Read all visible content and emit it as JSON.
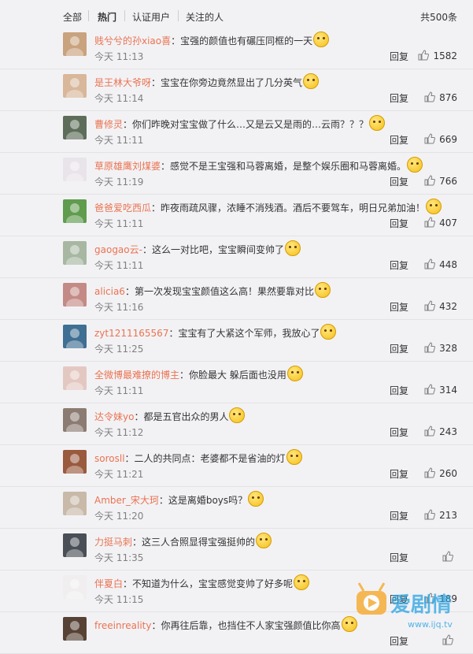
{
  "tabs": {
    "all": "全部",
    "hot": "热门",
    "verified": "认证用户",
    "following": "关注的人",
    "total": "共500条"
  },
  "labels": {
    "reply": "回复"
  },
  "comments": [
    {
      "user": "贱兮兮的孙xiao喜",
      "text": "：宝强的颜值也有碾压同框的一天",
      "time": "今天 11:13",
      "likes": "1582",
      "avatar": "#c9a27e"
    },
    {
      "user": "是王林大爷呀",
      "text": "：宝宝在你旁边竟然显出了几分英气",
      "time": "今天 11:14",
      "likes": "876",
      "avatar": "#d8b79a"
    },
    {
      "user": "曹修灵",
      "text": "：你们昨晚对宝宝做了什么…又是云又是雨的…云雨？？？",
      "time": "今天 11:11",
      "likes": "669",
      "avatar": "#5d6d5a"
    },
    {
      "user": "草原雄鹰刘煤婆",
      "text": "：感觉不是王宝强和马蓉离婚，是整个娱乐圈和马蓉离婚。",
      "time": "今天 11:19",
      "likes": "766",
      "avatar": "#e9e4ea"
    },
    {
      "user": "爸爸爱吃西瓜",
      "text": "：昨夜雨疏风骤，浓睡不消残酒。酒后不要驾车，明日兄弟加油！",
      "time": "今天 11:11",
      "likes": "407",
      "avatar": "#5f9c4e"
    },
    {
      "user": "gaogao云-",
      "text": "：这么一对比吧，宝宝瞬间变帅了",
      "time": "今天 11:11",
      "likes": "448",
      "avatar": "#a7b7a2"
    },
    {
      "user": "alicia6",
      "text": "：第一次发现宝宝颜值这么高！果然要靠对比",
      "time": "今天 11:16",
      "likes": "432",
      "avatar": "#c48a86"
    },
    {
      "user": "zyt1211165567",
      "text": "：宝宝有了大紧这个军师，我放心了",
      "time": "今天 11:25",
      "likes": "328",
      "avatar": "#3f6f92"
    },
    {
      "user": "全微博最难撩的博主",
      "text": "：你脸最大 躲后面也没用",
      "time": "今天 11:11",
      "likes": "314",
      "avatar": "#e3c8c2"
    },
    {
      "user": "达令妹yo",
      "text": "：都是五官出众的男人",
      "time": "今天 11:12",
      "likes": "243",
      "avatar": "#8c7b72"
    },
    {
      "user": "sorosll",
      "text": "：二人的共同点：老婆都不是省油的灯",
      "time": "今天 11:21",
      "likes": "260",
      "avatar": "#9a5a3e"
    },
    {
      "user": "Amber_宋大珂",
      "text": "：这是离婚boys吗？",
      "time": "今天 11:20",
      "likes": "213",
      "avatar": "#c8b9a8"
    },
    {
      "user": "力挺马刺",
      "text": "：这三人合照显得宝强挺帅的",
      "time": "今天 11:35",
      "likes": "",
      "avatar": "#4a4f57"
    },
    {
      "user": "伴夏白",
      "text": "：不知道为什么，宝宝感觉变帅了好多呢",
      "time": "今天 11:15",
      "likes": "189",
      "avatar": "#f0eeee"
    },
    {
      "user": "freeinreality",
      "text": "：你再往后靠，也挡住不人家宝强颜值比你高",
      "time": "",
      "likes": "",
      "avatar": "#574235"
    }
  ],
  "watermark": {
    "text": "爱剧情",
    "url": "www.ijq.tv"
  },
  "colors": {
    "username": "#eb7350",
    "background": "#f2f2f5",
    "accent": "#ff8c00"
  }
}
